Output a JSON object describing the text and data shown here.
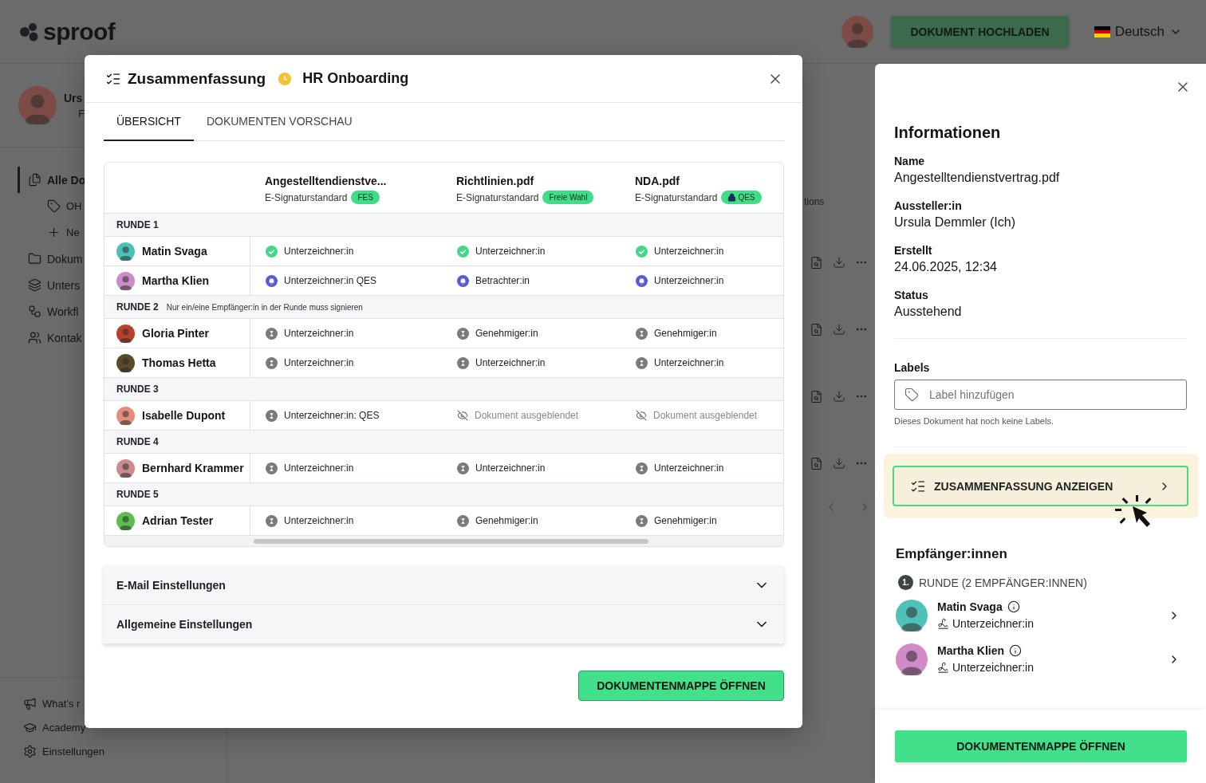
{
  "header": {
    "logo": "sproof",
    "upload_button": "DOKUMENT HOCHLADEN",
    "language": "Deutsch"
  },
  "sidebar": {
    "user": {
      "name": "Urs",
      "subtitle": "F"
    },
    "items": [
      {
        "kind": "documents",
        "label": "Alle Do",
        "selected": true,
        "children": [
          {
            "kind": "tag",
            "label": "OH",
            "selected": false
          },
          {
            "kind": "plus",
            "label": "Ne",
            "selected": false
          }
        ]
      },
      {
        "kind": "folder",
        "label": "Dokum",
        "selected": false
      },
      {
        "kind": "layers",
        "label": "Unters",
        "selected": false
      },
      {
        "kind": "workflow",
        "label": "Workfl",
        "selected": false
      },
      {
        "kind": "contacts",
        "label": "Kontak",
        "selected": false
      }
    ],
    "footer_items": [
      {
        "kind": "megaphone",
        "label": "What’s r"
      },
      {
        "kind": "academy",
        "label": "Academy"
      },
      {
        "kind": "settings",
        "label": "Einstellungen"
      }
    ]
  },
  "main": {
    "column_header": "tions"
  },
  "modal": {
    "title": "Zusammenfassung",
    "workflow": "HR Onboarding",
    "tabs": [
      {
        "label": "ÜBERSICHT",
        "selected": true
      },
      {
        "label": "DOKUMENTEN VORSCHAU",
        "selected": false
      }
    ],
    "documents": [
      {
        "name": "Angestelltendienstve...",
        "standard": "E-Signaturstandard",
        "badge": "FES",
        "locked": false
      },
      {
        "name": "Richtlinien.pdf",
        "standard": "E-Signaturstandard",
        "badge": "Freie Wahl",
        "locked": false
      },
      {
        "name": "NDA.pdf",
        "standard": "E-Signaturstandard",
        "badge": "QES",
        "locked": true
      }
    ],
    "rounds": [
      {
        "label": "RUNDE 1",
        "recipients": [
          {
            "name": "Matin Svaga",
            "color": "#4cc0b5",
            "cells": [
              {
                "kind": "done",
                "text": "Unterzeichner:in"
              },
              {
                "kind": "done",
                "text": "Unterzeichner:in"
              },
              {
                "kind": "done",
                "text": "Unterzeichner:in"
              }
            ]
          },
          {
            "name": "Martha Klien",
            "color": "#cc8cc6",
            "cells": [
              {
                "kind": "notified",
                "text": "Unterzeichner:in QES"
              },
              {
                "kind": "notified",
                "text": "Betrachter:in"
              },
              {
                "kind": "notified",
                "text": "Unterzeichner:in"
              }
            ]
          }
        ]
      },
      {
        "label": "RUNDE 2",
        "note": "Nur ein/eine Empfänger:in in der Runde muss signieren",
        "recipients": [
          {
            "name": "Gloria Pinter",
            "color": "#b8402c",
            "cells": [
              {
                "kind": "waiting",
                "text": "Unterzeichner:in"
              },
              {
                "kind": "waiting",
                "text": "Genehmiger:in"
              },
              {
                "kind": "waiting",
                "text": "Genehmiger:in"
              }
            ]
          },
          {
            "name": "Thomas Hetta",
            "color": "#5a4a2a",
            "cells": [
              {
                "kind": "waiting",
                "text": "Unterzeichner:in"
              },
              {
                "kind": "waiting",
                "text": "Unterzeichner:in"
              },
              {
                "kind": "waiting",
                "text": "Unterzeichner:in"
              }
            ]
          }
        ]
      },
      {
        "label": "RUNDE 3",
        "recipients": [
          {
            "name": "Isabelle Dupont",
            "color": "#e0907a",
            "cells": [
              {
                "kind": "waiting",
                "text": "Unterzeichner:in: QES"
              },
              {
                "kind": "hidden",
                "text": "Dokument ausgeblendet"
              },
              {
                "kind": "hidden",
                "text": "Dokument ausgeblendet"
              }
            ]
          }
        ]
      },
      {
        "label": "RUNDE 4",
        "recipients": [
          {
            "name": "Bernhard Krammer",
            "color": "#c98b8b",
            "cells": [
              {
                "kind": "waiting",
                "text": "Unterzeichner:in"
              },
              {
                "kind": "waiting",
                "text": "Unterzeichner:in"
              },
              {
                "kind": "waiting",
                "text": "Unterzeichner:in"
              }
            ]
          }
        ]
      },
      {
        "label": "RUNDE 5",
        "recipients": [
          {
            "name": "Adrian Tester",
            "color": "#5bbf4f",
            "cells": [
              {
                "kind": "waiting",
                "text": "Unterzeichner:in"
              },
              {
                "kind": "waiting",
                "text": "Genehmiger:in"
              },
              {
                "kind": "waiting",
                "text": "Genehmiger:in"
              }
            ]
          }
        ]
      }
    ],
    "accordions": [
      {
        "label": "E-Mail Einstellungen",
        "expanded": false
      },
      {
        "label": "Allgemeine Einstellungen",
        "expanded": false
      }
    ],
    "open_button": "DOKUMENTENMAPPE ÖFFNEN"
  },
  "drawer": {
    "title": "Informationen",
    "fields": [
      {
        "label": "Name",
        "value": "Angestelltendienstvertrag.pdf"
      },
      {
        "label": "Aussteller:in",
        "value": "Ursula Demmler (Ich)"
      },
      {
        "label": "Erstellt",
        "value": "24.06.2025, 12:34"
      },
      {
        "label": "Status",
        "value": "Ausstehend"
      }
    ],
    "labels": {
      "heading": "Labels",
      "placeholder": "Label hinzufügen",
      "hint": "Dieses Dokument hat noch keine Labels."
    },
    "summary_button": {
      "label": "ZUSAMMENFASSUNG ANZEIGEN",
      "highlighted": true
    },
    "recipients": {
      "heading": "Empfänger:innen",
      "round_number": "1.",
      "round_label": "RUNDE (2 EMPFÄNGER:INNEN)",
      "people": [
        {
          "name": "Matin Svaga",
          "role": "Unterzeichner:in",
          "color": "#4fc1b8"
        },
        {
          "name": "Martha Klien",
          "role": "Unterzeichner:in",
          "color": "#d08bc8"
        }
      ]
    },
    "open_button": "DOKUMENTENMAPPE ÖFFNEN"
  }
}
